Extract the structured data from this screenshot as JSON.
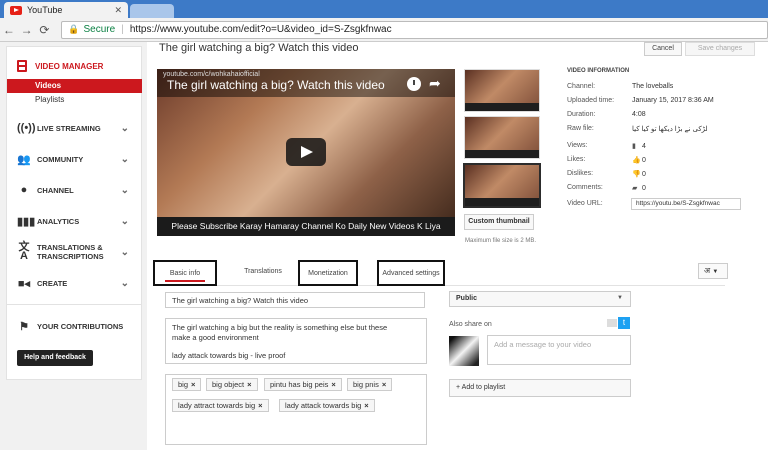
{
  "browser": {
    "tab_title": "YouTube",
    "tab_close": "✕",
    "secure_label": "Secure",
    "url": "https://www.youtube.com/edit?o=U&video_id=S-Zsgkfnwac"
  },
  "sidebar": {
    "header": "VIDEO MANAGER",
    "sub_items": [
      "Videos",
      "Playlists"
    ],
    "items": [
      {
        "label": "LIVE STREAMING",
        "icon": "live-icon"
      },
      {
        "label": "COMMUNITY",
        "icon": "community-icon"
      },
      {
        "label": "CHANNEL",
        "icon": "channel-icon"
      },
      {
        "label": "ANALYTICS",
        "icon": "analytics-icon"
      },
      {
        "label": "TRANSLATIONS & TRANSCRIPTIONS",
        "icon": "translate-icon"
      },
      {
        "label": "CREATE",
        "icon": "create-icon"
      },
      {
        "label": "YOUR CONTRIBUTIONS",
        "icon": "contributions-icon"
      }
    ],
    "help_button": "Help and feedback"
  },
  "header": {
    "title": "The girl watching a big? Watch this video",
    "cancel": "Cancel",
    "save": "Save changes"
  },
  "player": {
    "watermark": "youtube.com/c/wohkahaiofficial",
    "title": "The girl watching a big? Watch this video",
    "caption": "Please Subscribe Karay Hamaray Channel Ko Daily New Videos K Liya"
  },
  "thumbnails": {
    "custom_button": "Custom thumbnail",
    "max_size": "Maximum file size is 2 MB."
  },
  "video_info": {
    "heading": "VIDEO INFORMATION",
    "channel_label": "Channel:",
    "channel": "The loveballs",
    "uploaded_label": "Uploaded time:",
    "uploaded": "January 15, 2017 8:36 AM",
    "duration_label": "Duration:",
    "duration": "4:08",
    "rawfile_label": "Raw file:",
    "rawfile": "لڑکی نے بڑا دیکھا تو کیا کیا",
    "views_label": "Views:",
    "views": "4",
    "likes_label": "Likes:",
    "likes": "0",
    "dislikes_label": "Dislikes:",
    "dislikes": "0",
    "comments_label": "Comments:",
    "comments": "0",
    "url_label": "Video URL:",
    "url": "https://youtu.be/S-Zsgkfnwac"
  },
  "tabs": [
    "Basic info",
    "Translations",
    "Monetization",
    "Advanced settings"
  ],
  "lang_button": "अ",
  "form": {
    "title": "The girl watching a big? Watch this video",
    "description_line1": "The girl watching a big but the reality is something else but these",
    "description_line2": "make a good environment",
    "description_line3": "lady attack towards big - live proof",
    "tags": [
      "big",
      "big object",
      "pintu has big peis",
      "big pnis",
      "lady attract towards big",
      "lady attack towards big"
    ],
    "tag_remove": "×",
    "privacy": "Public",
    "also_share": "Also share on",
    "message_placeholder": "Add a message to your video",
    "add_playlist": "+ Add to playlist"
  },
  "colors": {
    "accent_red": "#cc181e",
    "twitter_blue": "#1da1f2",
    "browser_blue": "#3d7ac7"
  }
}
